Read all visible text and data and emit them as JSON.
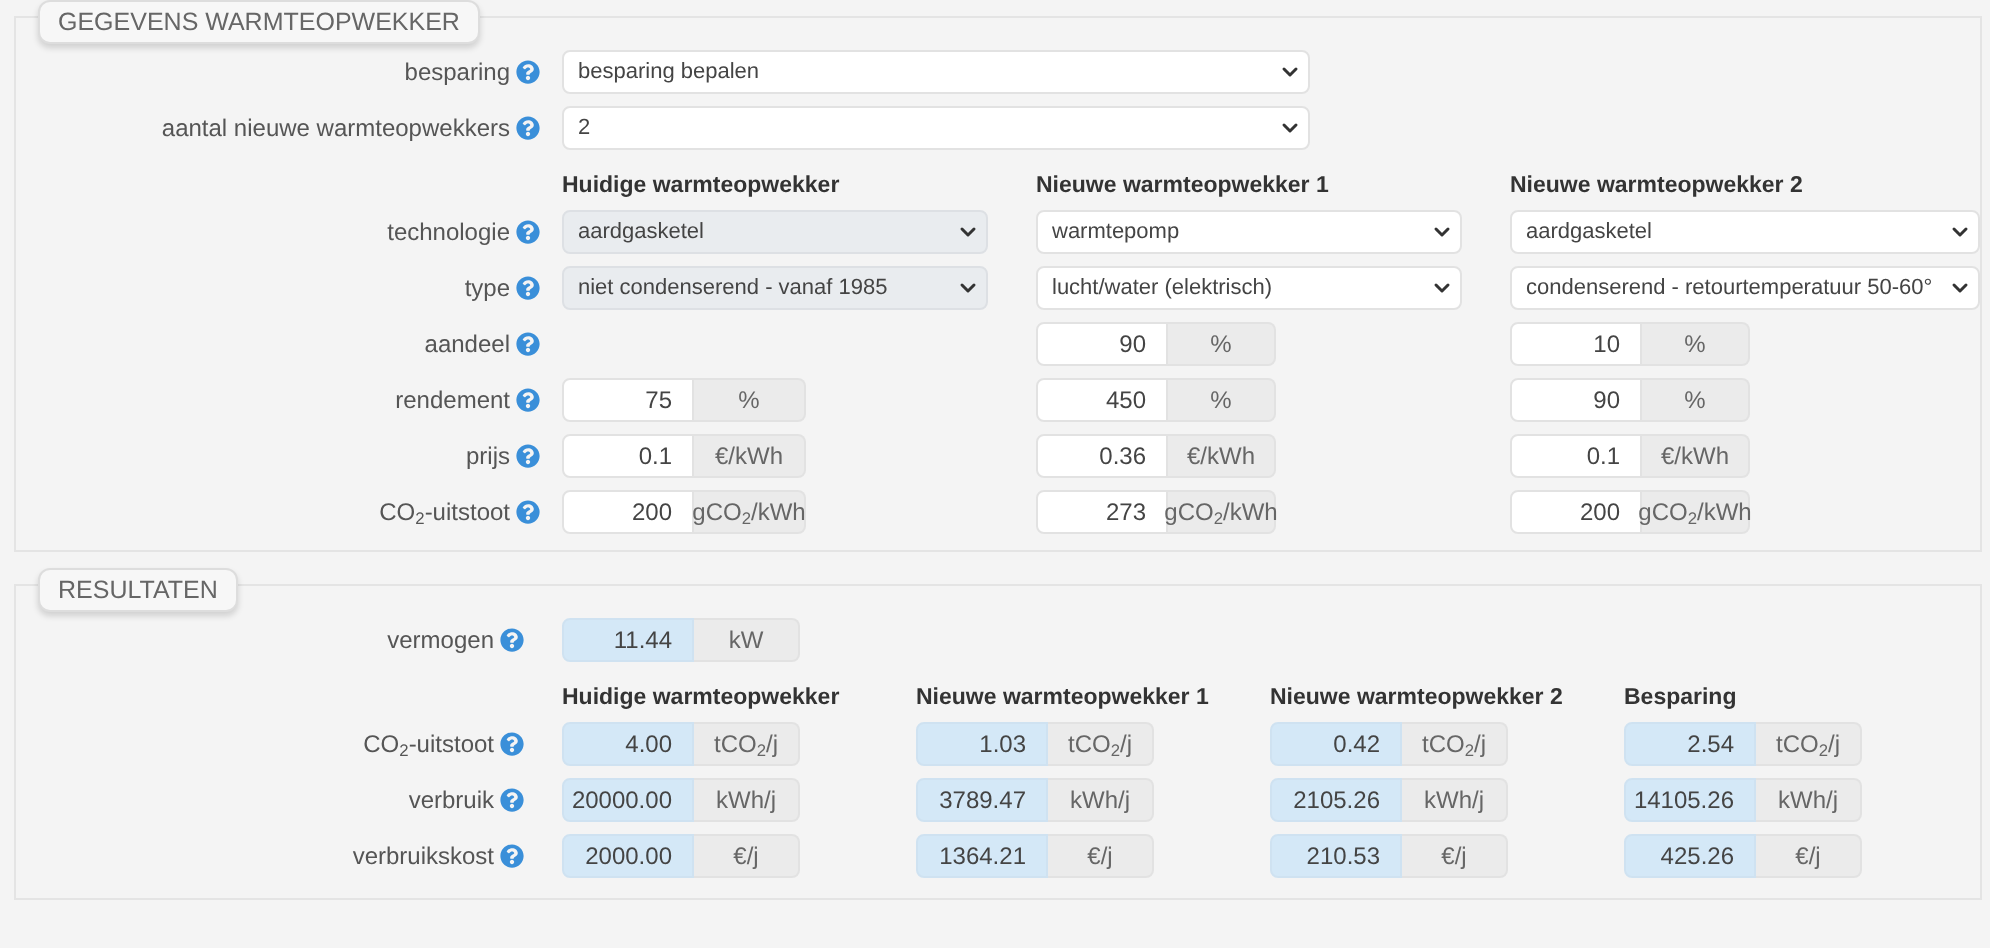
{
  "gegevens": {
    "legend": "GEGEVENS WARMTEOPWEKKER",
    "top_rows": [
      {
        "label": "besparing",
        "value": "besparing bepalen"
      },
      {
        "label": "aantal nieuwe warmteopwekkers",
        "value": "2"
      }
    ],
    "columns": [
      "Huidige warmteopwekker",
      "Nieuwe warmteopwekker 1",
      "Nieuwe warmteopwekker 2"
    ],
    "rows": [
      {
        "label": "technologie",
        "kind": "select",
        "cells": [
          {
            "value": "aardgasketel",
            "disabled": true
          },
          {
            "value": "warmtepomp",
            "disabled": false
          },
          {
            "value": "aardgasketel",
            "disabled": false
          }
        ]
      },
      {
        "label": "type",
        "kind": "select",
        "cells": [
          {
            "value": "niet condenserend - vanaf 1985",
            "disabled": true
          },
          {
            "value": "lucht/water (elektrisch)",
            "disabled": false
          },
          {
            "value": "condenserend - retourtemperatuur 50-60°",
            "disabled": false
          }
        ]
      },
      {
        "label": "aandeel",
        "kind": "input",
        "cells": [
          null,
          {
            "value": "90",
            "unit": "%"
          },
          {
            "value": "10",
            "unit": "%"
          }
        ]
      },
      {
        "label": "rendement",
        "kind": "input",
        "cells": [
          {
            "value": "75",
            "unit": "%"
          },
          {
            "value": "450",
            "unit": "%"
          },
          {
            "value": "90",
            "unit": "%"
          }
        ]
      },
      {
        "label": "prijs",
        "kind": "input",
        "cells": [
          {
            "value": "0.1",
            "unit": "€/kWh"
          },
          {
            "value": "0.36",
            "unit": "€/kWh"
          },
          {
            "value": "0.1",
            "unit": "€/kWh"
          }
        ]
      },
      {
        "label": "CO$_{2}$-uitstoot",
        "kind": "input",
        "cells": [
          {
            "value": "200",
            "unit": "gCO$_{2}$/kWh"
          },
          {
            "value": "273",
            "unit": "gCO$_{2}$/kWh"
          },
          {
            "value": "200",
            "unit": "gCO$_{2}$/kWh"
          }
        ]
      }
    ]
  },
  "resultaten": {
    "legend": "RESULTATEN",
    "vermogen": {
      "label": "vermogen",
      "value": "11.44",
      "unit": "kW"
    },
    "columns": [
      "Huidige warmteopwekker",
      "Nieuwe warmteopwekker 1",
      "Nieuwe warmteopwekker 2",
      "Besparing"
    ],
    "rows": [
      {
        "label": "CO$_{2}$-uitstoot",
        "cells": [
          {
            "value": "4.00",
            "unit": "tCO$_{2}$/j"
          },
          {
            "value": "1.03",
            "unit": "tCO$_{2}$/j"
          },
          {
            "value": "0.42",
            "unit": "tCO$_{2}$/j"
          },
          {
            "value": "2.54",
            "unit": "tCO$_{2}$/j"
          }
        ]
      },
      {
        "label": "verbruik",
        "cells": [
          {
            "value": "20000.00",
            "unit": "kWh/j"
          },
          {
            "value": "3789.47",
            "unit": "kWh/j"
          },
          {
            "value": "2105.26",
            "unit": "kWh/j"
          },
          {
            "value": "14105.26",
            "unit": "kWh/j"
          }
        ]
      },
      {
        "label": "verbruikskost",
        "cells": [
          {
            "value": "2000.00",
            "unit": "€/j"
          },
          {
            "value": "1364.21",
            "unit": "€/j"
          },
          {
            "value": "210.53",
            "unit": "€/j"
          },
          {
            "value": "425.26",
            "unit": "€/j"
          }
        ]
      }
    ]
  }
}
